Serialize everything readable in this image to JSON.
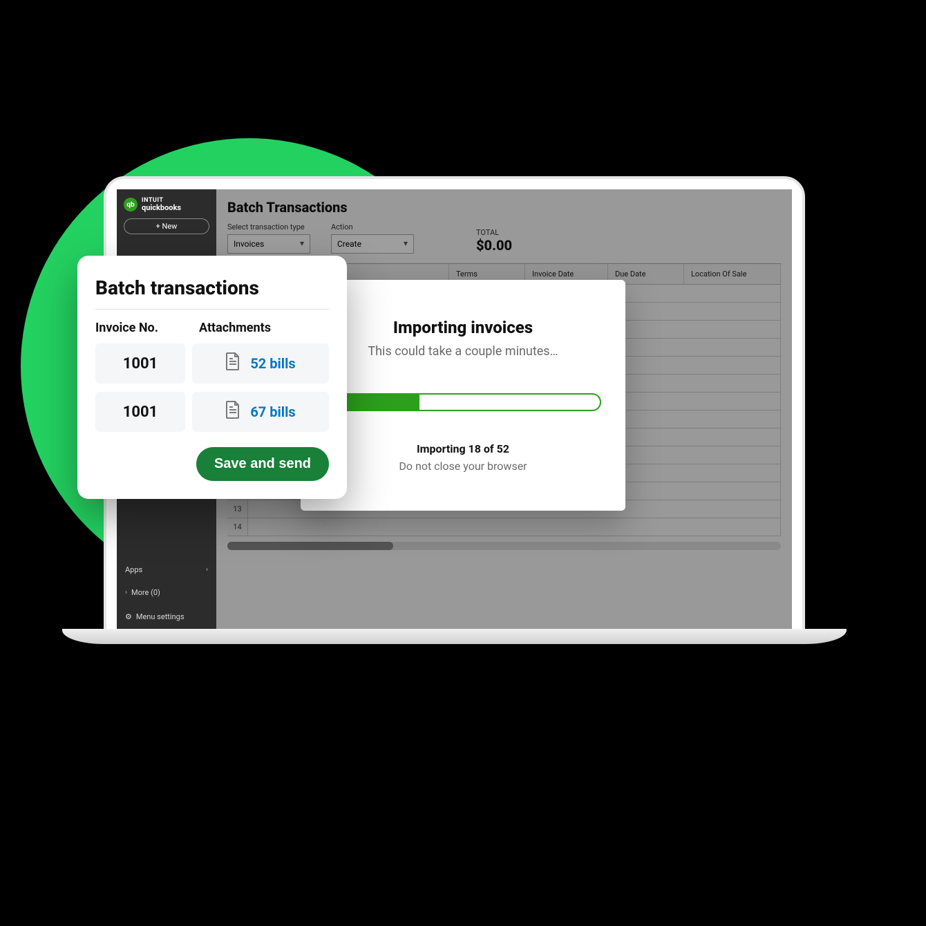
{
  "brand": {
    "line1": "INTUIT",
    "line2": "quickbooks",
    "badge": "qb"
  },
  "sidebar": {
    "new_label": "+ New",
    "apps_label": "Apps",
    "more_label": "More (0)",
    "menu_settings": "Menu settings"
  },
  "page": {
    "title": "Batch Transactions",
    "select_type_label": "Select transaction type",
    "select_type_value": "Invoices",
    "action_label": "Action",
    "action_value": "Create",
    "total_label": "TOTAL",
    "total_value": "$0.00",
    "columns": [
      "Terms",
      "Invoice Date",
      "Due Date",
      "Location Of Sale"
    ]
  },
  "import": {
    "title": "Importing invoices",
    "subtitle": "This could take a couple minutes…",
    "status": "Importing 18 of 52",
    "note": "Do not close your browser",
    "progress_pct": 34
  },
  "batch": {
    "title": "Batch transactions",
    "col1": "Invoice No.",
    "col2": "Attachments",
    "rows": [
      {
        "invoice": "1001",
        "bills": "52 bills"
      },
      {
        "invoice": "1001",
        "bills": "67 bills"
      }
    ],
    "save_label": "Save and send"
  }
}
